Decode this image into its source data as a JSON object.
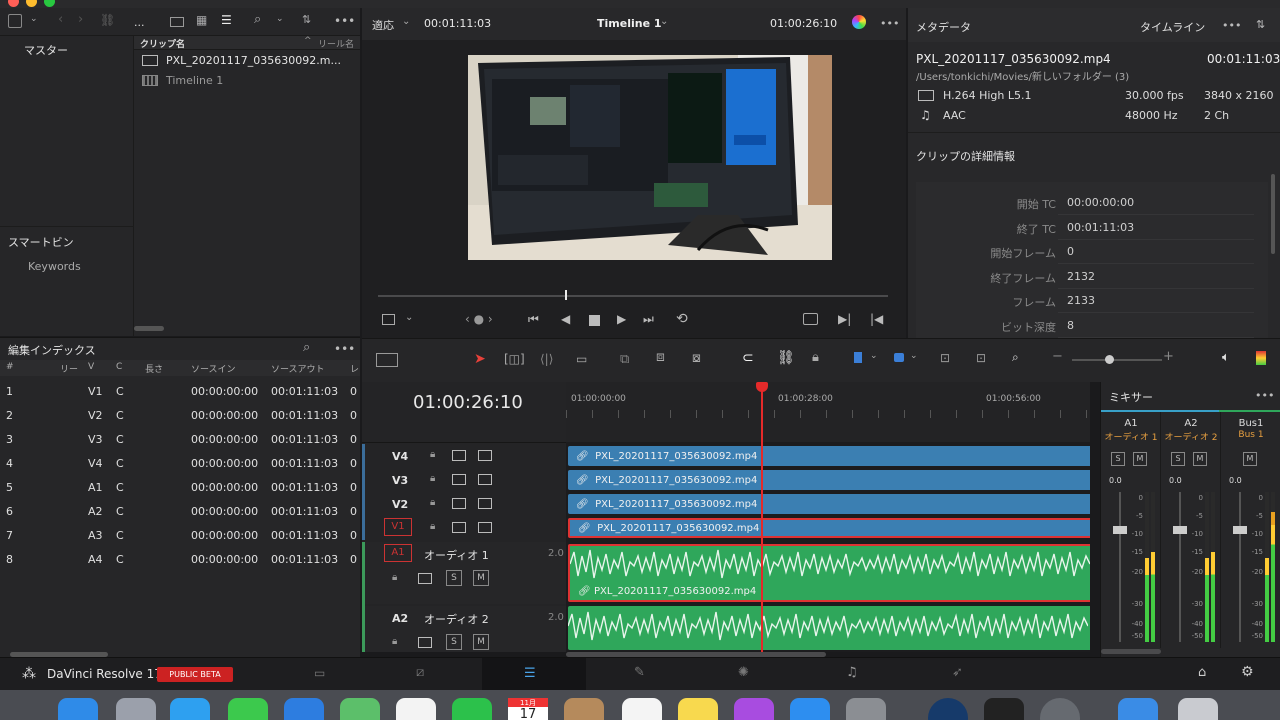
{
  "viewer": {
    "fit_label": "適応",
    "source_tc": "00:01:11:03",
    "timeline_name": "Timeline 1",
    "record_tc": "01:00:26:10"
  },
  "media_pool": {
    "bins_title": "マスター",
    "smart_bins_title": "スマートビン",
    "smart_bin_item": "Keywords",
    "col_clip_name": "クリップ名",
    "col_reel": "リール名",
    "clips": [
      {
        "name": "PXL_20201117_035630092.m..."
      },
      {
        "name": "Timeline 1"
      }
    ]
  },
  "metadata": {
    "title": "メタデータ",
    "tab_timeline": "タイムライン",
    "filename": "PXL_20201117_035630092.mp4",
    "duration": "00:01:11:03",
    "path": "/Users/tonkichi/Movies/新しいフォルダー (3)",
    "video_codec": "H.264 High L5.1",
    "fps": "30.000 fps",
    "resolution": "3840 x 2160",
    "audio_codec": "AAC",
    "sample_rate": "48000 Hz",
    "channels": "2 Ch",
    "details_title": "クリップの詳細情報",
    "fields": [
      {
        "label": "開始 TC",
        "value": "00:00:00:00"
      },
      {
        "label": "終了 TC",
        "value": "00:01:11:03"
      },
      {
        "label": "開始フレーム",
        "value": "0"
      },
      {
        "label": "終了フレーム",
        "value": "2132"
      },
      {
        "label": "フレーム",
        "value": "2133"
      },
      {
        "label": "ビット深度",
        "value": "8"
      }
    ]
  },
  "edit_index": {
    "title": "編集インデックス",
    "columns": [
      "#",
      "リー",
      "V",
      "C",
      "長さ",
      "ソースイン",
      "ソースアウト",
      "レ"
    ],
    "rows": [
      {
        "n": "1",
        "v": "V1",
        "c": "C",
        "src_in": "00:00:00:00",
        "src_out": "00:01:11:03",
        "rec": "0"
      },
      {
        "n": "2",
        "v": "V2",
        "c": "C",
        "src_in": "00:00:00:00",
        "src_out": "00:01:11:03",
        "rec": "0"
      },
      {
        "n": "3",
        "v": "V3",
        "c": "C",
        "src_in": "00:00:00:00",
        "src_out": "00:01:11:03",
        "rec": "0"
      },
      {
        "n": "4",
        "v": "V4",
        "c": "C",
        "src_in": "00:00:00:00",
        "src_out": "00:01:11:03",
        "rec": "0"
      },
      {
        "n": "5",
        "v": "A1",
        "c": "C",
        "src_in": "00:00:00:00",
        "src_out": "00:01:11:03",
        "rec": "0"
      },
      {
        "n": "6",
        "v": "A2",
        "c": "C",
        "src_in": "00:00:00:00",
        "src_out": "00:01:11:03",
        "rec": "0"
      },
      {
        "n": "7",
        "v": "A3",
        "c": "C",
        "src_in": "00:00:00:00",
        "src_out": "00:01:11:03",
        "rec": "0"
      },
      {
        "n": "8",
        "v": "A4",
        "c": "C",
        "src_in": "00:00:00:00",
        "src_out": "00:01:11:03",
        "rec": "0"
      }
    ]
  },
  "timeline": {
    "timecode": "01:00:26:10",
    "ruler": [
      "01:00:00:00",
      "01:00:28:00",
      "01:00:56:00"
    ],
    "clip_name": "PXL_20201117_035630092.mp4",
    "tracks": {
      "v4": "V4",
      "v3": "V3",
      "v2": "V2",
      "v1": "V1",
      "a1": "A1",
      "a1_name": "オーディオ 1",
      "a1_ch": "2.0",
      "a2": "A2",
      "a2_name": "オーディオ 2",
      "a2_ch": "2.0",
      "s": "S",
      "m": "M"
    }
  },
  "mixer": {
    "title": "ミキサー",
    "channels": [
      "A1",
      "A2",
      "Bus1"
    ],
    "sub": [
      "オーディオ 1",
      "オーディオ 2",
      "Bus 1"
    ],
    "value": "0.0",
    "scale": [
      "0",
      "-5",
      "-10",
      "-15",
      "-20",
      "-30",
      "-40",
      "-50"
    ]
  },
  "app": {
    "name": "DaVinci Resolve 17",
    "badge": "PUBLIC BETA"
  },
  "dock": {
    "calendar_month": "11月",
    "calendar_day": "17"
  }
}
